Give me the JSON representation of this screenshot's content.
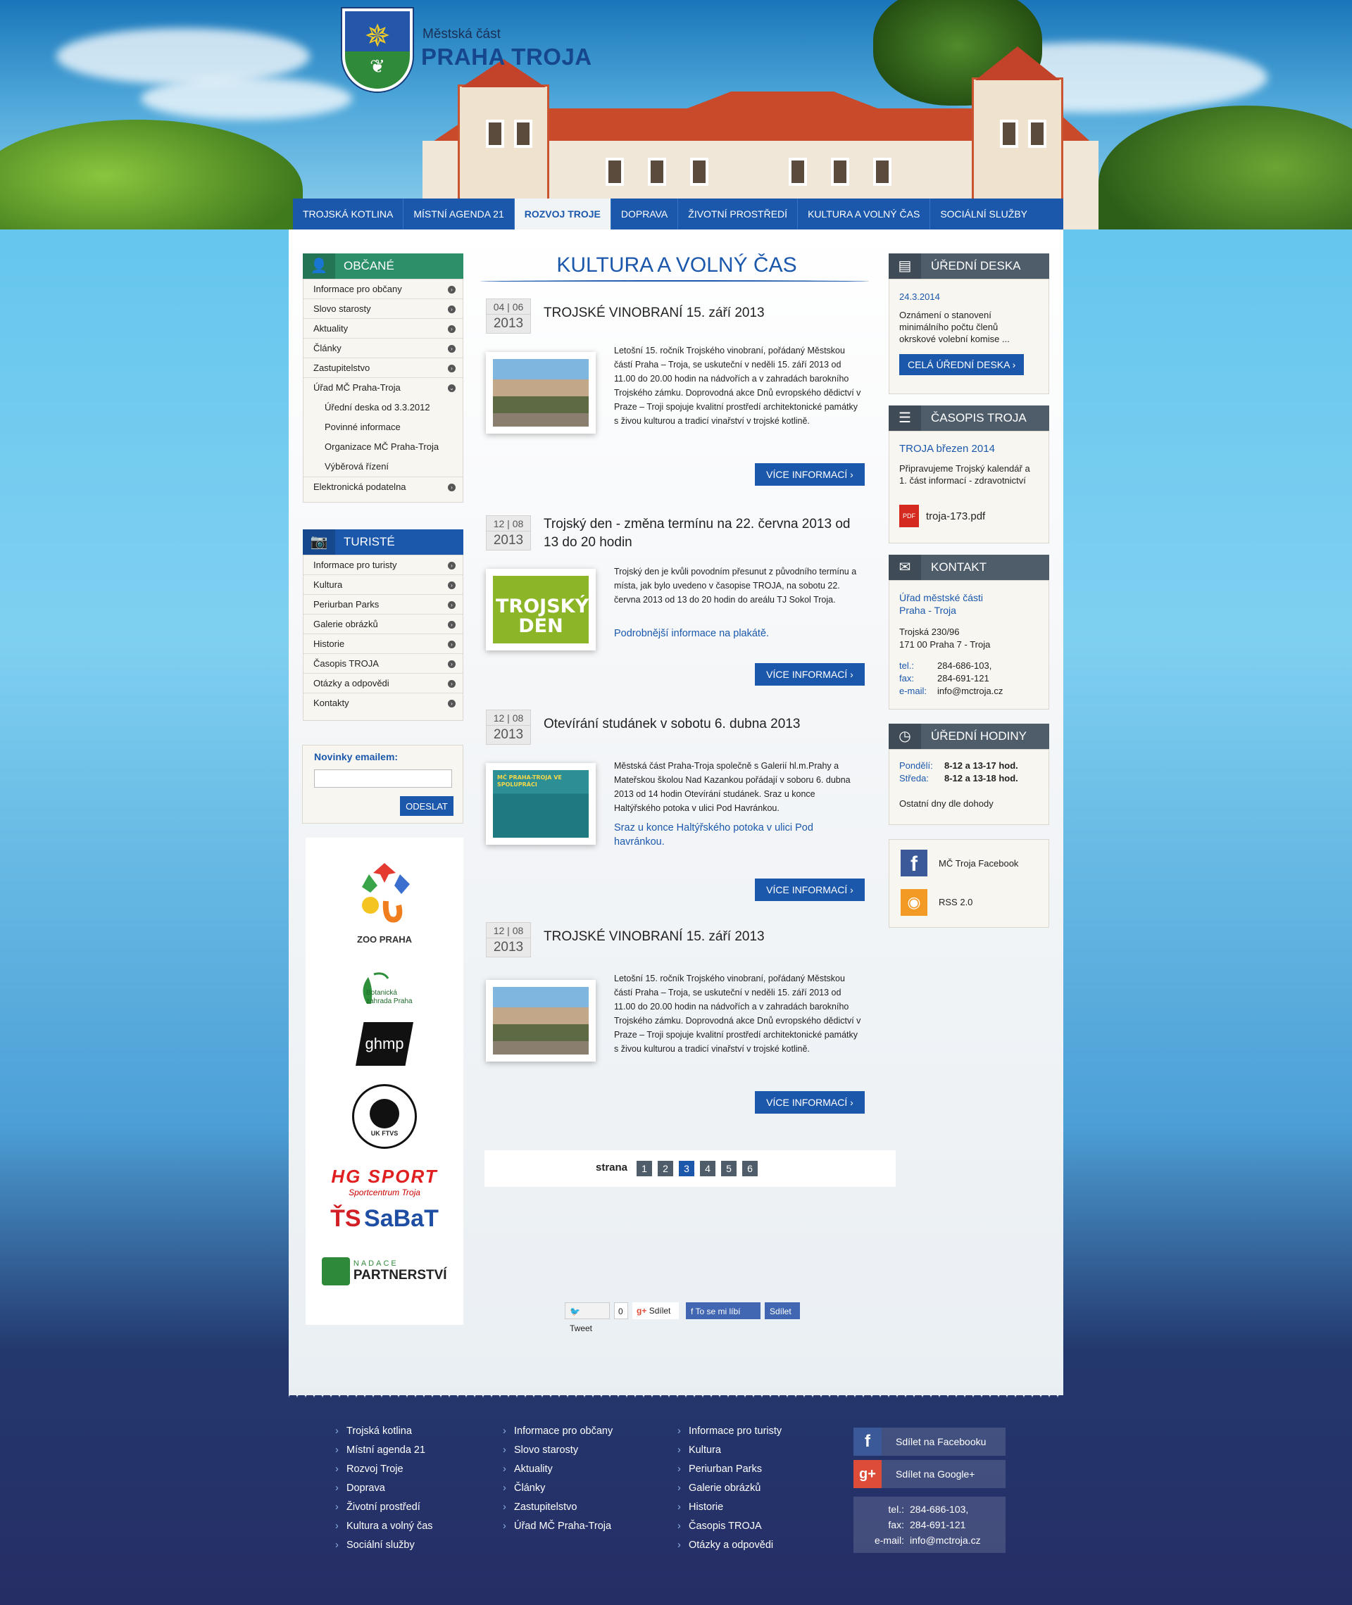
{
  "header": {
    "logo_small": "Městská část",
    "logo_big": "PRAHA TROJA"
  },
  "nav": [
    {
      "label": "TROJSKÁ KOTLINA"
    },
    {
      "label": "MÍSTNÍ AGENDA 21"
    },
    {
      "label": "ROZVOJ TROJE",
      "active": true
    },
    {
      "label": "DOPRAVA"
    },
    {
      "label": "ŽIVOTNÍ PROSTŘEDÍ"
    },
    {
      "label": "KULTURA A VOLNÝ ČAS"
    },
    {
      "label": "SOCIÁLNÍ SLUŽBY"
    }
  ],
  "left": {
    "obcane_title": "OBČANÉ",
    "obcane_items": [
      "Informace pro občany",
      "Slovo starosty",
      "Aktuality",
      "Články",
      "Zastupitelstvo",
      "Úřad MČ Praha-Troja"
    ],
    "obcane_sub": [
      "Úřední deska od 3.3.2012",
      "Povinné informace",
      "Organizace MČ Praha-Troja",
      "Výběrová řízení"
    ],
    "obcane_last": "Elektronická podatelna",
    "turiste_title": "TURISTÉ",
    "turiste_items": [
      "Informace pro turisty",
      "Kultura",
      "Periurban Parks",
      "Galerie obrázků",
      "Historie",
      "Časopis TROJA",
      "Otázky a odpovědi",
      "Kontakty"
    ],
    "newsletter_label": "Novinky emailem:",
    "newsletter_button": "ODESLAT",
    "partners": {
      "zoo": "ZOO PRAHA",
      "botanic": "Botanická zahrada Praha",
      "ghmp": "ghmp",
      "ftvs": "UK FTVS",
      "hgsport": "HG SPORT",
      "hgsport_sub": "Sportcentrum Troja",
      "sabat": "SaBaT",
      "nadace": "NADACE",
      "partnerstvi": "PARTNERSTVÍ"
    }
  },
  "main": {
    "section_title": "KULTURA A VOLNÝ ČAS",
    "articles": [
      {
        "day": "04",
        "month": "06",
        "year": "2013",
        "title": "TROJSKÉ VINOBRANÍ 15. září 2013",
        "text": "Letošní 15. ročník Trojského vinobraní, pořádaný Městskou částí Praha – Troja, se uskuteční v neděli 15. září 2013 od 11.00 do 20.00 hodin na nádvořích a v zahradách barokního Trojského zámku. Doprovodná akce Dnů evropského dědictví v Praze – Troji spojuje kvalitní prostředí architektonické památky s živou kulturou a tradicí vinařství v trojské kotlině.",
        "link": "",
        "more": "VÍCE INFORMACÍ"
      },
      {
        "day": "12",
        "month": "08",
        "year": "2013",
        "title": "Trojský den - změna termínu na 22. června 2013 od 13 do 20 hodin",
        "text": "Trojský den je kvůli povodním přesunut z původního termínu a místa, jak bylo uvedeno v časopise TROJA, na sobotu 22. června 2013 od 13 do 20 hodin do areálu TJ Sokol Troja.",
        "link": "Podrobnější informace na plakátě.",
        "more": "VÍCE INFORMACÍ"
      },
      {
        "day": "12",
        "month": "08",
        "year": "2013",
        "title": "Otevírání studánek v sobotu 6. dubna 2013",
        "text": "Městská část Praha-Troja společně s Galerií hl.m.Prahy a Mateřskou školou Nad Kazankou pořádají v soboru 6. dubna 2013 od 14 hodin Otevírání studánek. Sraz u konce Haltýřského potoka v ulici Pod Havránkou.",
        "link": "Sraz u konce Haltýřského potoka v ulici Pod havránkou.",
        "more": "VÍCE INFORMACÍ"
      },
      {
        "day": "12",
        "month": "08",
        "year": "2013",
        "title": "TROJSKÉ VINOBRANÍ 15. září 2013",
        "text": "Letošní 15. ročník Trojského vinobraní, pořádaný Městskou částí Praha – Troja, se uskuteční v neděli 15. září 2013 od 11.00 do 20.00 hodin na nádvořích a v zahradách barokního Trojského zámku. Doprovodná akce Dnů evropského dědictví v Praze – Troji spojuje kvalitní prostředí architektonické památky s živou kulturou a tradicí vinařství v trojské kotlině.",
        "link": "",
        "more": "VÍCE INFORMACÍ"
      }
    ],
    "thumb2_label": "TROJSKÝ DEN",
    "thumb3_label": "MČ PRAHA-TROJA VE SPOLUPRÁCI",
    "pager_label": "strana",
    "pages": [
      "1",
      "2",
      "3",
      "4",
      "5",
      "6"
    ],
    "current_page": "3",
    "share": {
      "tweet": "Tweet",
      "tweet_count": "0",
      "gplus": "Sdílet",
      "fb_like": "To se mi líbí",
      "fb_share": "Sdílet"
    }
  },
  "right": {
    "deska_title": "ÚŘEDNÍ DESKA",
    "deska_date": "24.3.2014",
    "deska_text": "Oznámení o stanovení minimálního počtu členů okrskové volební komise ...",
    "deska_button": "CELÁ ÚŘEDNÍ DESKA",
    "casopis_title": "ČASOPIS TROJA",
    "casopis_issue": "TROJA březen 2014",
    "casopis_text": "Připravujeme Trojský kalendář a 1. část informací - zdravotnictví",
    "casopis_file": "troja-173.pdf",
    "kontakt_title": "KONTAKT",
    "kontakt_org1": "Úřad městské části",
    "kontakt_org2": "Praha - Troja",
    "kontakt_addr1": "Trojská 230/96",
    "kontakt_addr2": "171 00 Praha 7 - Troja",
    "tel_label": "tel.:",
    "tel": "284-686-103,",
    "fax_label": "fax:",
    "fax": "284-691-121",
    "email_label": "e-mail:",
    "email": "info@mctroja.cz",
    "hodiny_title": "ÚŘEDNÍ HODINY",
    "pondeli_label": "Pondělí:",
    "pondeli": "8-12 a 13-17 hod.",
    "streda_label": "Středa:",
    "streda": "8-12 a 13-18 hod.",
    "ostatni": "Ostatní dny dle dohody",
    "facebook": "MČ Troja Facebook",
    "rss": "RSS 2.0"
  },
  "footer": {
    "col1": [
      "Trojská kotlina",
      "Místní agenda 21",
      "Rozvoj Troje",
      "Doprava",
      "Životní prostředí",
      "Kultura a volný čas",
      "Sociální služby"
    ],
    "col2": [
      "Informace pro občany",
      "Slovo starosty",
      "Aktuality",
      "Články",
      "Zastupitelstvo",
      "Úřad MČ Praha-Troja"
    ],
    "col3": [
      "Informace pro turisty",
      "Kultura",
      "Periurban Parks",
      "Galerie obrázků",
      "Historie",
      "Časopis TROJA",
      "Otázky a odpovědi"
    ],
    "share_fb": "Sdílet na Facebooku",
    "share_gplus": "Sdílet na Google+",
    "tel_label": "tel.:",
    "tel": "284-686-103,",
    "fax_label": "fax:",
    "fax": "284-691-121",
    "email_label": "e-mail:",
    "email": "info@mctroja.cz"
  }
}
